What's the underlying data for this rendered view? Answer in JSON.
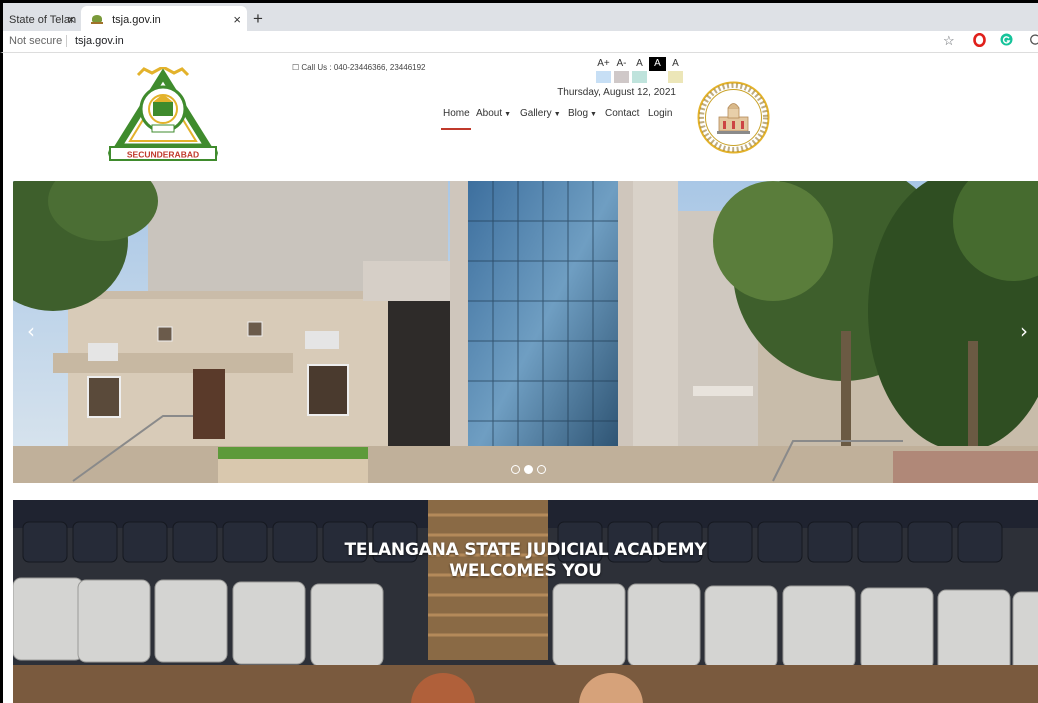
{
  "browser": {
    "tabs": [
      {
        "title": "State of Telan",
        "close": "×"
      },
      {
        "title": "tsja.gov.in",
        "close": "×"
      }
    ],
    "new_tab": "+",
    "security": "Not secure",
    "url": "tsja.gov.in"
  },
  "header": {
    "call_us": "☐  Call Us : 040-23446366, 23446192",
    "font_controls": [
      "A+",
      "A-",
      "A",
      "A",
      "A"
    ],
    "font_swatches": [
      "#c7dff5",
      "#cfc8c8",
      "#bfe3dc",
      "#ffffff",
      "#ece6b8"
    ],
    "date": "Thursday, August 12, 2021",
    "nav": [
      {
        "label": "Home",
        "dropdown": false
      },
      {
        "label": "About",
        "dropdown": true
      },
      {
        "label": "Gallery",
        "dropdown": true
      },
      {
        "label": "Blog",
        "dropdown": true
      },
      {
        "label": "Contact",
        "dropdown": false
      },
      {
        "label": "Login",
        "dropdown": false
      }
    ],
    "logo_left_text": "SECUNDERABAD",
    "colors": {
      "accent": "#c0392b",
      "logo_green": "#3f8b2d",
      "logo_gold": "#e3b22b"
    }
  },
  "carousel": {
    "prev": "‹",
    "next": "›",
    "slide_count": 3,
    "active_slide": 2
  },
  "welcome": {
    "line1": "TELANGANA STATE JUDICIAL ACADEMY",
    "line2": "WELCOMES YOU"
  }
}
